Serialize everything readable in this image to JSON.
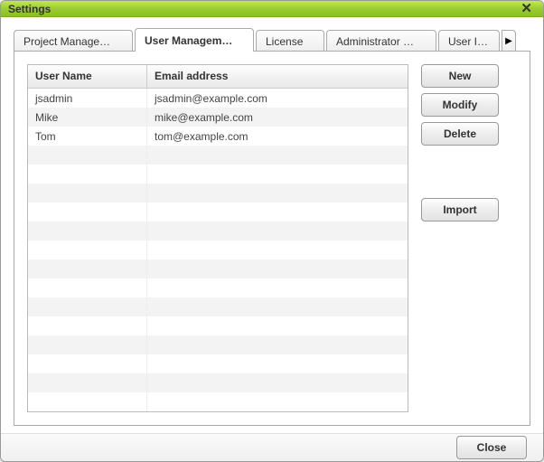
{
  "window": {
    "title": "Settings"
  },
  "tabs": [
    {
      "label": "Project Manage…"
    },
    {
      "label": "User Managem…"
    },
    {
      "label": "License"
    },
    {
      "label": "Administrator …"
    },
    {
      "label": "User Info"
    }
  ],
  "active_tab_index": 1,
  "grid": {
    "columns": {
      "user": "User Name",
      "email": "Email address"
    },
    "rows": [
      {
        "user": "jsadmin",
        "email": "jsadmin@example.com"
      },
      {
        "user": "Mike",
        "email": "mike@example.com"
      },
      {
        "user": "Tom",
        "email": "tom@example.com"
      }
    ],
    "visible_row_count": 17
  },
  "buttons": {
    "new": "New",
    "modify": "Modify",
    "delete": "Delete",
    "import": "Import",
    "close": "Close"
  }
}
